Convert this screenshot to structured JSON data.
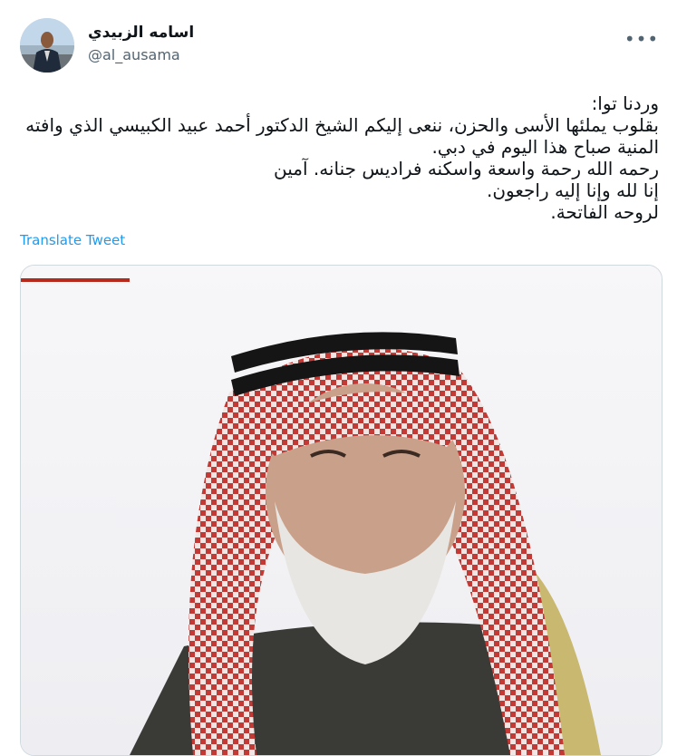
{
  "author": {
    "display_name": "اسامه الزبيدي",
    "handle": "@al_ausama"
  },
  "more_icon": "more-horizontal-icon",
  "tweet": {
    "lines": [
      "وردنا توا:",
      "بقلوب يملئها الأسى والحزن، ننعى إليكم الشيخ الدكتور أحمد عبيد الكبيسي الذي وافته",
      "المنية صباح هذا اليوم في دبي.",
      "رحمه الله رحمة واسعة واسكنه فراديس جنانه. آمين",
      "إنا لله وإنا إليه راجعون.",
      "لروحه الفاتحة."
    ],
    "translate_label": "Translate Tweet"
  },
  "colors": {
    "link": "#1d9bf0",
    "secondary_text": "#536471",
    "accent_bar": "#b52a1c"
  }
}
